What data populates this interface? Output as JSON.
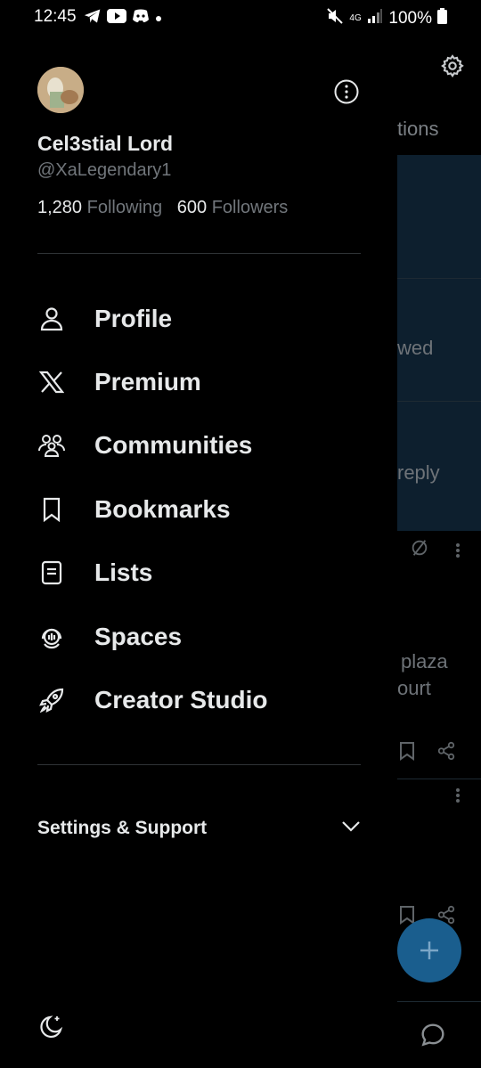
{
  "status_bar": {
    "time": "12:45",
    "battery": "100%",
    "network": "4G"
  },
  "profile": {
    "display_name": "Cel3stial Lord",
    "handle": "@XaLegendary1",
    "following_count": "1,280",
    "following_label": "Following",
    "followers_count": "600",
    "followers_label": "Followers"
  },
  "menu": {
    "items": [
      {
        "label": "Profile",
        "icon": "person-icon"
      },
      {
        "label": "Premium",
        "icon": "x-logo-icon"
      },
      {
        "label": "Communities",
        "icon": "communities-icon"
      },
      {
        "label": "Bookmarks",
        "icon": "bookmark-icon"
      },
      {
        "label": "Lists",
        "icon": "list-icon"
      },
      {
        "label": "Spaces",
        "icon": "spaces-icon"
      },
      {
        "label": "Creator Studio",
        "icon": "rocket-icon"
      }
    ]
  },
  "settings_support": {
    "label": "Settings & Support"
  },
  "background": {
    "tab_fragment": "tions",
    "fragment_1": "wed",
    "fragment_2": "reply",
    "fragment_3": "plaza",
    "fragment_4": "ourt"
  },
  "colors": {
    "background": "#000000",
    "text_primary": "#e7e9ea",
    "text_secondary": "#71767b",
    "divider": "#2f3336",
    "fab": "#1a5e8e"
  }
}
